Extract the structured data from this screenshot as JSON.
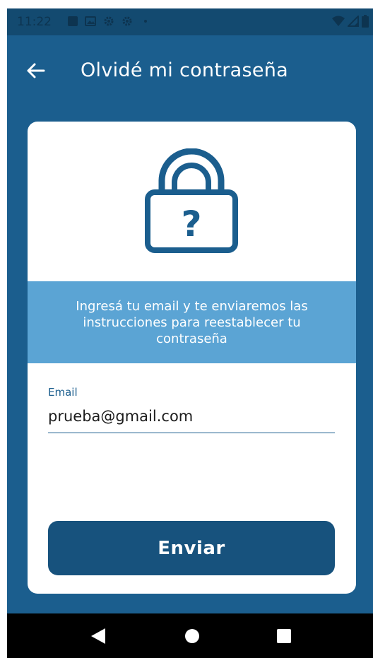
{
  "status_bar": {
    "time": "11:22",
    "icons_left": [
      "notification-icon",
      "gallery-icon",
      "gear-icon",
      "gear-icon",
      "dot-icon"
    ],
    "icons_right": [
      "wifi-icon",
      "signal-icon",
      "battery-icon"
    ]
  },
  "header": {
    "title": "Olvidé mi contraseña",
    "back_icon": "arrow-left-icon"
  },
  "card": {
    "icon": "lock-question-icon",
    "info_text": "Ingresá tu email y te enviaremos las instrucciones para reestablecer tu contraseña",
    "email_label": "Email",
    "email_value": "prueba@gmail.com",
    "submit_label": "Enviar"
  },
  "nav_bar": {
    "buttons": [
      "nav-back-icon",
      "nav-home-icon",
      "nav-recents-icon"
    ]
  },
  "colors": {
    "primary": "#1b5e8e",
    "button": "#17527d",
    "info_band": "#5ba4d4",
    "status_bar": "#134a70"
  }
}
